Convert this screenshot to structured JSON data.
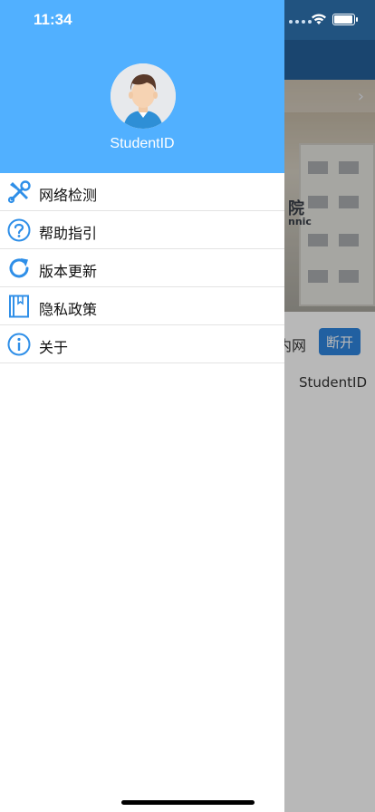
{
  "status_bar": {
    "time": "11:34"
  },
  "drawer": {
    "username": "StudentID",
    "menu": [
      {
        "label": "网络检测",
        "icon": "tools-icon"
      },
      {
        "label": "帮助指引",
        "icon": "question-icon"
      },
      {
        "label": "版本更新",
        "icon": "refresh-icon"
      },
      {
        "label": "隐私政策",
        "icon": "book-icon"
      },
      {
        "label": "关于",
        "icon": "info-icon"
      }
    ]
  },
  "background_app": {
    "banner_text": "院",
    "banner_subtext": "nnic",
    "network_label": "内网",
    "disconnect_label": "断开",
    "username": "StudentID"
  },
  "colors": {
    "drawer_header": "#51b0ff",
    "icon_blue": "#2f8fe8",
    "disconnect_button": "#2f86e0"
  }
}
